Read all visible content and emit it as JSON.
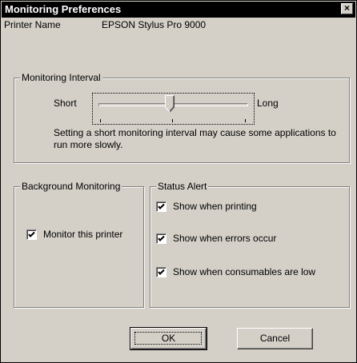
{
  "window": {
    "title": "Monitoring Preferences",
    "close_symbol": "×"
  },
  "printer": {
    "label": "Printer Name",
    "value": "EPSON Stylus Pro 9000"
  },
  "monitoring_interval": {
    "title": "Monitoring Interval",
    "short_label": "Short",
    "long_label": "Long",
    "slider_value": 0.46,
    "note": "Setting a short monitoring interval may cause some applications to run more slowly."
  },
  "background_monitoring": {
    "title": "Background Monitoring",
    "monitor_label": "Monitor this printer",
    "monitor_checked": true
  },
  "status_alert": {
    "title": "Status Alert",
    "items": [
      {
        "label": "Show when printing",
        "checked": true
      },
      {
        "label": "Show when errors occur",
        "checked": true
      },
      {
        "label": "Show when consumables are low",
        "checked": true
      }
    ]
  },
  "buttons": {
    "ok": "OK",
    "cancel": "Cancel"
  },
  "colors": {
    "face": "#d4d0c8",
    "titlebar": "#000000"
  }
}
